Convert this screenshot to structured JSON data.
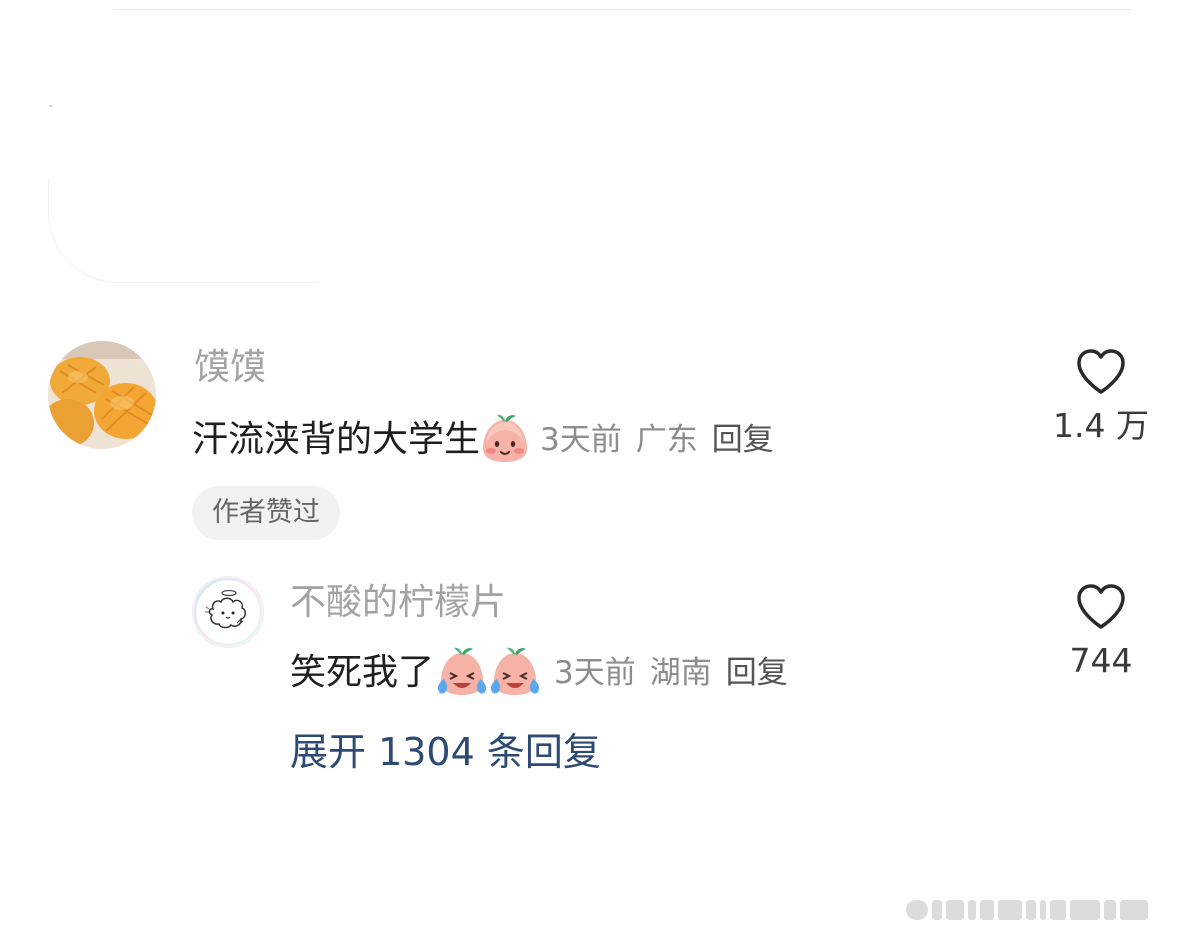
{
  "comment": {
    "username": "馍馍",
    "text": "汗流浃背的大学生",
    "emoji": "blush-peach-emoji",
    "time": "3天前",
    "location": "广东",
    "reply_label": "回复",
    "like_count": "1.4 万",
    "badge": "作者赞过"
  },
  "reply": {
    "username": "不酸的柠檬片",
    "text": "笑死我了",
    "emoji": "laugh-cry-peach-emoji",
    "time": "3天前",
    "location": "湖南",
    "reply_label": "回复",
    "like_count": "744"
  },
  "expand_label": "展开 1304 条回复",
  "icons": {
    "like": "heart-outline-icon"
  },
  "colors": {
    "username": "#a3a3a3",
    "meta": "#8d8d8d",
    "expand_link": "#2c4a73",
    "badge_bg": "#f2f2f2"
  }
}
